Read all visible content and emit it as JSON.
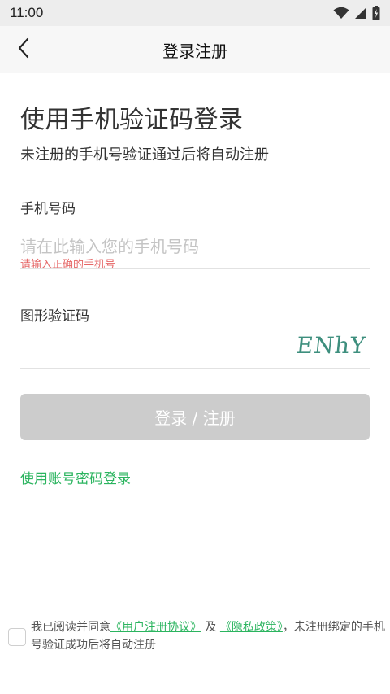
{
  "status_bar": {
    "time": "11:00",
    "icons": [
      "wifi-icon",
      "signal-icon",
      "battery-icon"
    ]
  },
  "header": {
    "back_icon": "chevron-left-icon",
    "title": "登录注册"
  },
  "form": {
    "title": "使用手机验证码登录",
    "subtitle": "未注册的手机号验证通过后将自动注册",
    "phone_label": "手机号码",
    "phone_placeholder": "请在此输入您的手机号码",
    "phone_value": "",
    "phone_error": "请输入正确的手机号",
    "captcha_label": "图形验证码",
    "captcha_value": "",
    "captcha_image_text": "ENhY",
    "submit_label": "登录 / 注册",
    "alt_login_label": "使用账号密码登录"
  },
  "agreement": {
    "checked": false,
    "prefix": "我已阅读并同意",
    "user_agreement": "《用户注册协议》",
    "conjunction": " 及 ",
    "privacy_policy": "《隐私政策》",
    "suffix": "，未注册绑定的手机号验证成功后将自动注册"
  },
  "colors": {
    "accent_green": "#2bb45f",
    "error_red": "#e56767",
    "disabled_button": "#cccccc",
    "captcha_text": "#3e8f7e"
  }
}
